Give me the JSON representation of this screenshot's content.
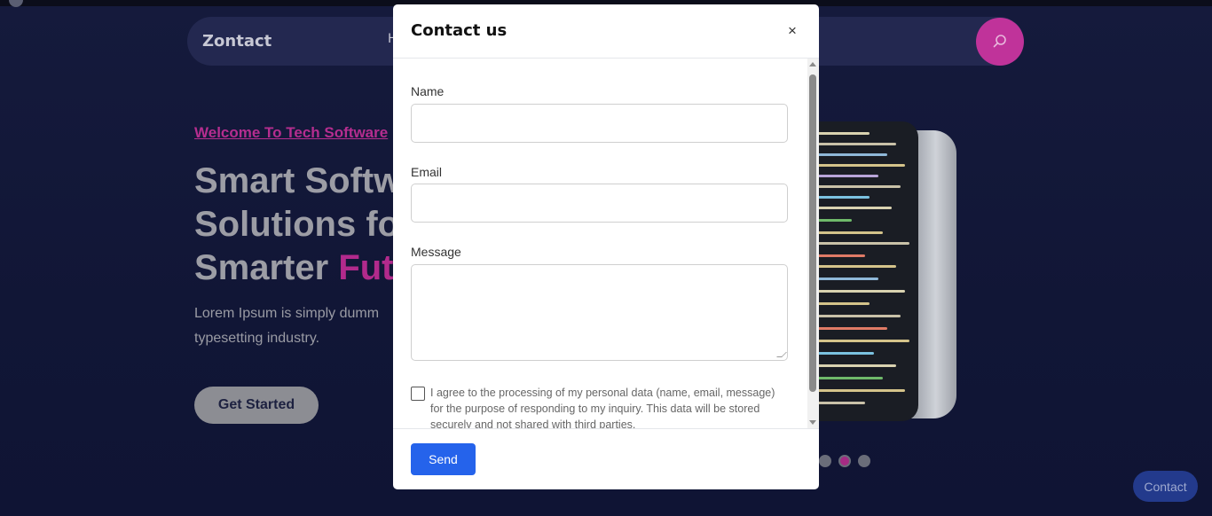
{
  "background": {
    "brand": "Zontact",
    "nav_first_letter": "H",
    "welcome": "Welcome To Tech Software",
    "hero_line1": "Smart Softw",
    "hero_line2": "Solutions fo",
    "hero_line3_plain": "Smarter ",
    "hero_line3_accent": "Fut",
    "hero_desc_line1": "Lorem Ipsum is simply dumm",
    "hero_desc_line2": "typesetting industry.",
    "get_started": "Get Started",
    "contact_button": "Contact",
    "slider_dots": 3,
    "slider_active_index": 1,
    "colors": {
      "accent": "#c0339a",
      "navy": "#111636",
      "contact_blue": "#233a8c"
    }
  },
  "modal": {
    "title": "Contact us",
    "close_glyph": "×",
    "fields": {
      "name_label": "Name",
      "name_value": "",
      "email_label": "Email",
      "email_value": "",
      "message_label": "Message",
      "message_value": ""
    },
    "consent": {
      "checked": false,
      "text": "I agree to the processing of my personal data (name, email, message) for the purpose of responding to my inquiry. This data will be stored securely and not shared with third parties."
    },
    "send_label": "Send",
    "colors": {
      "send": "#2563eb"
    }
  }
}
